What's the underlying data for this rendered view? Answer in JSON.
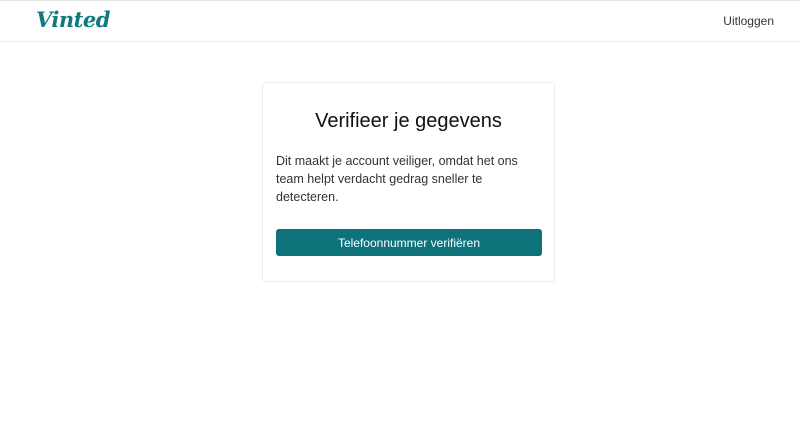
{
  "header": {
    "logo": "Vinted",
    "logout_label": "Uitloggen"
  },
  "card": {
    "title": "Verifieer je gegevens",
    "description": "Dit maakt je account veiliger, omdat het ons team helpt verdacht gedrag sneller te detecteren.",
    "button_label": "Telefoonnummer verifiëren"
  },
  "colors": {
    "brand": "#0e7a80",
    "button": "#0e727a"
  }
}
